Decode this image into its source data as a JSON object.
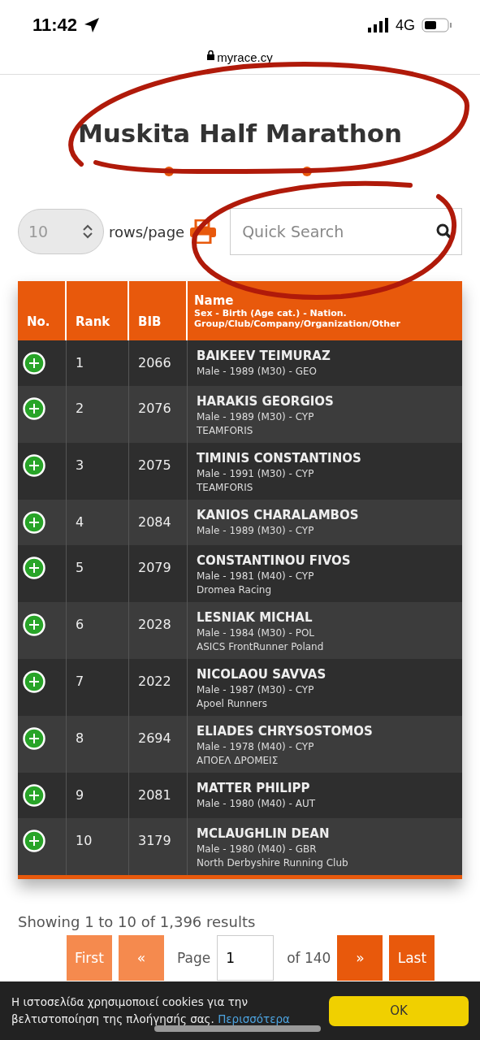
{
  "status_bar": {
    "time": "11:42",
    "network": "4G"
  },
  "address_bar": {
    "url": "myrace.cy"
  },
  "title": "Muskita Half Marathon",
  "controls": {
    "rows_per_page": "10",
    "rows_label": "rows/page",
    "search": {
      "placeholder": "Quick Search"
    }
  },
  "table": {
    "columns": [
      {
        "label": "No."
      },
      {
        "label": "Rank"
      },
      {
        "label": "BIB"
      },
      {
        "label": "Name",
        "sublines": [
          "Sex - Birth (Age cat.) - Nation.",
          "Group/Club/Company/Organization/Other"
        ]
      }
    ],
    "rows": [
      {
        "rank": "1",
        "bib": "2066",
        "name": "BAIKEEV TEIMURAZ",
        "details": "Male - 1989 (M30) - GEO"
      },
      {
        "rank": "2",
        "bib": "2076",
        "name": "HARAKIS GEORGIOS",
        "details": "Male - 1989 (M30) - CYP",
        "club": "TEAMFORIS"
      },
      {
        "rank": "3",
        "bib": "2075",
        "name": "TIMINIS CONSTANTINOS",
        "details": "Male - 1991 (M30) - CYP",
        "club": "TEAMFORIS"
      },
      {
        "rank": "4",
        "bib": "2084",
        "name": "KANIOS CHARALAMBOS",
        "details": "Male - 1989 (M30) - CYP"
      },
      {
        "rank": "5",
        "bib": "2079",
        "name": "CONSTANTINOU FIVOS",
        "details": "Male - 1981 (M40) - CYP",
        "club": "Dromea Racing"
      },
      {
        "rank": "6",
        "bib": "2028",
        "name": "LESNIAK MICHAL",
        "details": "Male - 1984 (M30) - POL",
        "club": "ASICS FrontRunner Poland"
      },
      {
        "rank": "7",
        "bib": "2022",
        "name": "NICOLAOU SAVVAS",
        "details": "Male - 1987 (M30) - CYP",
        "club": "Apoel Runners"
      },
      {
        "rank": "8",
        "bib": "2694",
        "name": "ELIADES CHRYSOSTOMOS",
        "details": "Male - 1978 (M40) - CYP",
        "club": "ΑΠΟΕΛ ΔΡΟΜΕΙΣ"
      },
      {
        "rank": "9",
        "bib": "2081",
        "name": "MATTER PHILIPP",
        "details": "Male - 1980 (M40) - AUT"
      },
      {
        "rank": "10",
        "bib": "3179",
        "name": "MCLAUGHLIN DEAN",
        "details": "Male - 1980 (M40) - GBR",
        "club": "North Derbyshire Running Club"
      }
    ]
  },
  "summary": "Showing 1 to 10 of 1,396 results",
  "pagination": {
    "first": "First",
    "prev": "«",
    "page_label": "Page",
    "page": "1",
    "of": "of 140",
    "next": "»",
    "last": "Last"
  },
  "cookie_banner": {
    "text": "Η ιστοσελίδα χρησιμοποιεί cookies για την βελτιστοποίηση της πλοήγησής σας.",
    "link": "Περισσότερα",
    "button": "OK"
  }
}
